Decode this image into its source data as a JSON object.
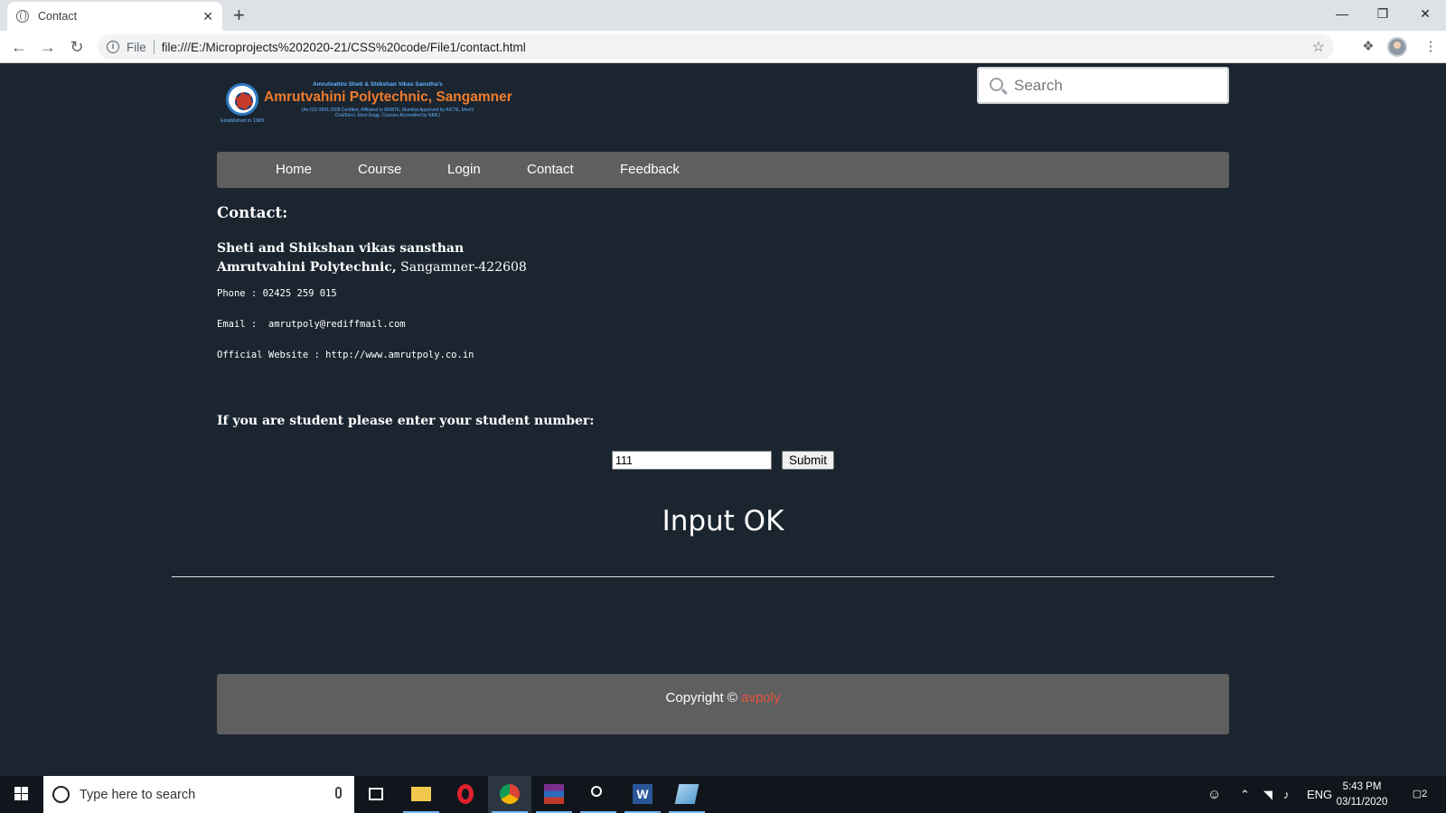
{
  "browser": {
    "tab_title": "Contact",
    "tab_close": "✕",
    "new_tab": "+",
    "file_label": "File",
    "url": "file:///E:/Microprojects%202020-21/CSS%20code/File1/contact.html"
  },
  "site": {
    "logo": {
      "top_line": "Amrutvahini Sheti & Shikshan Vikas Sanstha's",
      "name": "Amrutvahini Polytechnic, Sangamner",
      "subtitle": "(An ISO 9001:2008 Certified, Affiliated to MSBTE, Mumbai Approved by AICTE, Mech/ Civil/Elect. Elect Engg. Courses Accredited by NBA.)",
      "established": "Established in 1983"
    },
    "search_placeholder": "Search",
    "nav": [
      "Home",
      "Course",
      "Login",
      "Contact",
      "Feedback"
    ]
  },
  "contact": {
    "heading": "Contact:",
    "org_line1": "Sheti and Shikshan vikas sansthan",
    "org_line2_bold": "Amrutvahini Polytechnic,",
    "org_line2_rest": " Sangamner-422608",
    "phone": "Phone : 02425 259 015",
    "email": "Email :  amrutpoly@rediffmail.com",
    "website": "Official Website : http://www.amrutpoly.co.in"
  },
  "student": {
    "label": "If you are student please enter your student number:",
    "input_value": "111",
    "submit_label": "Submit",
    "result": "Input OK"
  },
  "footer": {
    "text": "Copyright © ",
    "brand": "avpoly"
  },
  "taskbar": {
    "search_placeholder": "Type here to search",
    "language": "ENG",
    "time": "5:43 PM",
    "date": "03/11/2020",
    "notifications": "2"
  },
  "colors": {
    "page_bg": "#1b2530",
    "nav_bg": "#5f5f5f",
    "brand_accent": "#e8553c",
    "logo_orange": "#f07c2c"
  }
}
